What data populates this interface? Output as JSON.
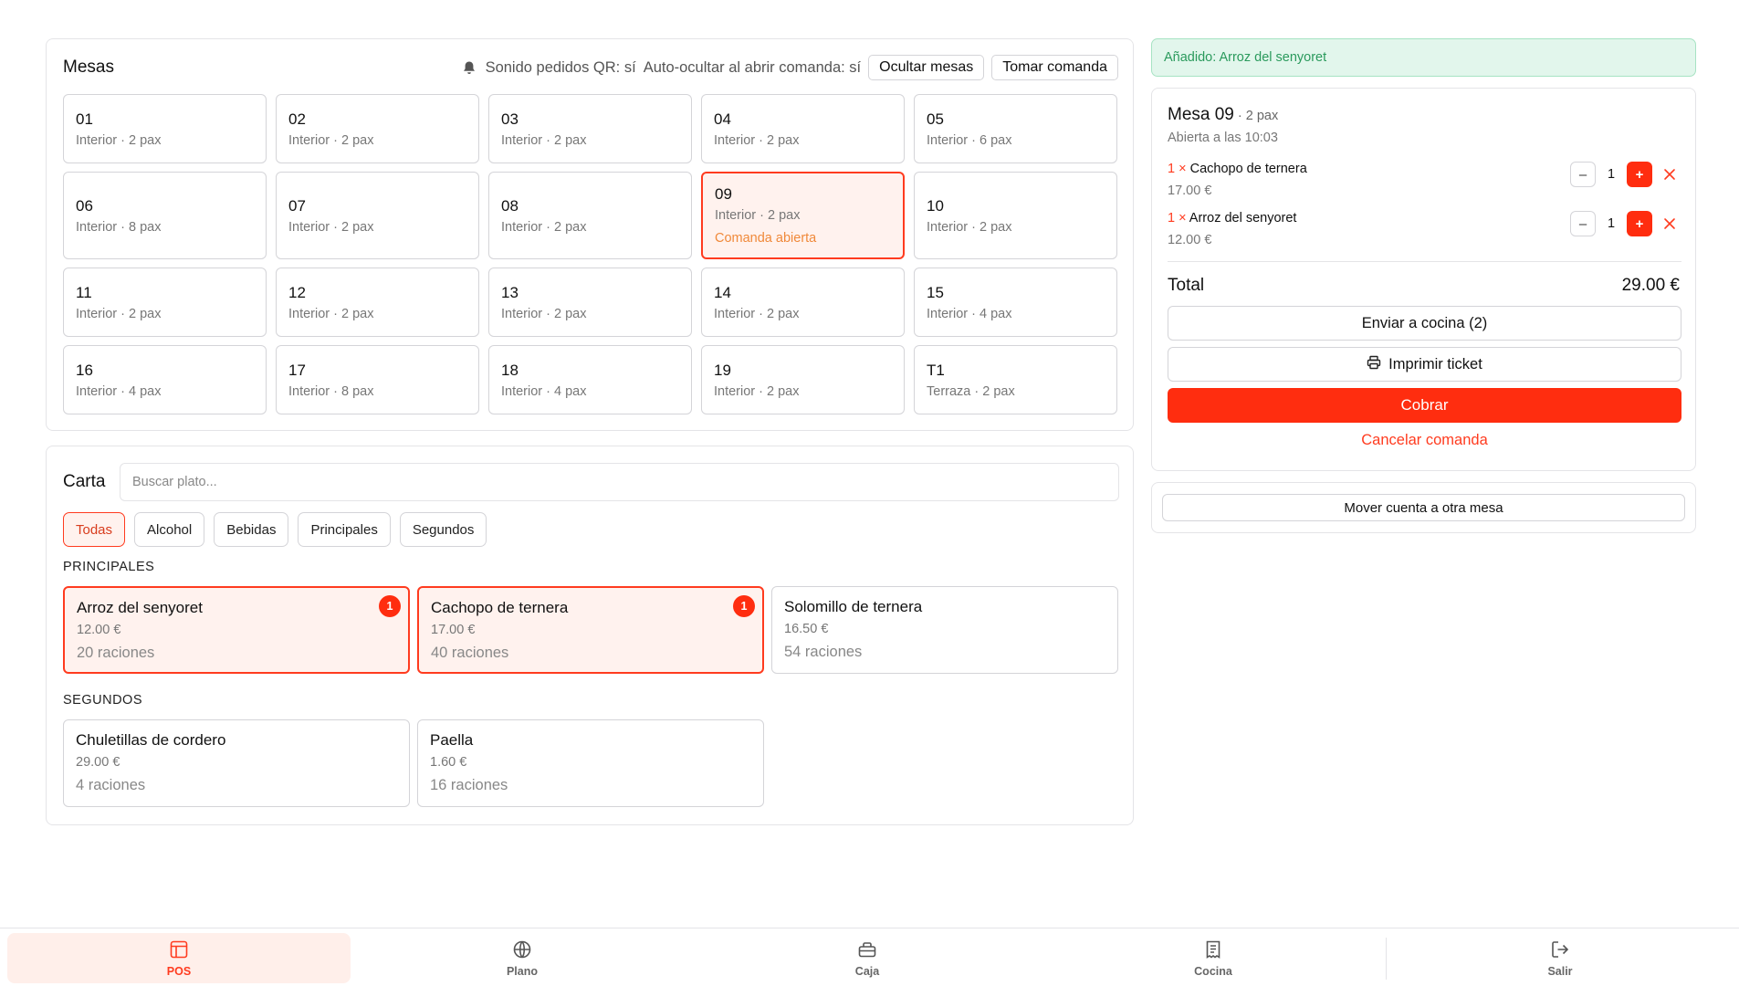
{
  "mesas": {
    "title": "Mesas",
    "qr_sound": "Sonido pedidos QR: sí",
    "auto_hide": "Auto-ocultar al abrir comanda: sí",
    "hide_button": "Ocultar mesas",
    "take_order_button": "Tomar comanda",
    "tables": [
      {
        "num": "01",
        "sub": "Interior · 2 pax"
      },
      {
        "num": "02",
        "sub": "Interior · 2 pax"
      },
      {
        "num": "03",
        "sub": "Interior · 2 pax"
      },
      {
        "num": "04",
        "sub": "Interior · 2 pax"
      },
      {
        "num": "05",
        "sub": "Interior · 6 pax"
      },
      {
        "num": "06",
        "sub": "Interior · 8 pax"
      },
      {
        "num": "07",
        "sub": "Interior · 2 pax"
      },
      {
        "num": "08",
        "sub": "Interior · 2 pax"
      },
      {
        "num": "09",
        "sub": "Interior · 2 pax",
        "status": "Comanda abierta"
      },
      {
        "num": "10",
        "sub": "Interior · 2 pax"
      },
      {
        "num": "11",
        "sub": "Interior · 2 pax"
      },
      {
        "num": "12",
        "sub": "Interior · 2 pax"
      },
      {
        "num": "13",
        "sub": "Interior · 2 pax"
      },
      {
        "num": "14",
        "sub": "Interior · 2 pax"
      },
      {
        "num": "15",
        "sub": "Interior · 4 pax"
      },
      {
        "num": "16",
        "sub": "Interior · 4 pax"
      },
      {
        "num": "17",
        "sub": "Interior · 8 pax"
      },
      {
        "num": "18",
        "sub": "Interior · 4 pax"
      },
      {
        "num": "19",
        "sub": "Interior · 2 pax"
      },
      {
        "num": "T1",
        "sub": "Terraza · 2 pax"
      }
    ]
  },
  "carta": {
    "title": "Carta",
    "search_placeholder": "Buscar plato...",
    "categories": [
      "Todas",
      "Alcohol",
      "Bebidas",
      "Principales",
      "Segundos"
    ],
    "active_category": "Todas",
    "sections": [
      {
        "label": "PRINCIPALES",
        "dishes": [
          {
            "name": "Arroz del senyoret",
            "price": "12.00 €",
            "stock": "20 raciones",
            "badge": "1"
          },
          {
            "name": "Cachopo de ternera",
            "price": "17.00 €",
            "stock": "40 raciones",
            "badge": "1"
          },
          {
            "name": "Solomillo de ternera",
            "price": "16.50 €",
            "stock": "54 raciones"
          }
        ]
      },
      {
        "label": "SEGUNDOS",
        "dishes": [
          {
            "name": "Chuletillas de cordero",
            "price": "29.00 €",
            "stock": "4 raciones"
          },
          {
            "name": "Paella",
            "price": "1.60 €",
            "stock": "16 raciones"
          }
        ]
      }
    ]
  },
  "toast": "Añadido: Arroz del senyoret",
  "order": {
    "title": "Mesa 09",
    "pax": "· 2 pax",
    "opened": "Abierta a las 10:03",
    "lines": [
      {
        "qty": "1 ×",
        "name": "Cachopo de ternera",
        "price": "17.00 €",
        "count": "1"
      },
      {
        "qty": "1 ×",
        "name": "Arroz del senyoret",
        "price": "12.00 €",
        "count": "1"
      }
    ],
    "minus": "–",
    "plus": "+",
    "total_label": "Total",
    "total_value": "29.00 €",
    "send_kitchen": "Enviar a cocina (2)",
    "print_ticket": "Imprimir ticket",
    "charge": "Cobrar",
    "cancel": "Cancelar comanda",
    "move": "Mover cuenta a otra mesa"
  },
  "nav": [
    {
      "label": "POS",
      "icon": "layout-icon",
      "active": true
    },
    {
      "label": "Plano",
      "icon": "globe-icon"
    },
    {
      "label": "Caja",
      "icon": "cash-register-icon"
    },
    {
      "label": "Cocina",
      "icon": "receipt-icon"
    },
    {
      "label": "Salir",
      "icon": "logout-icon"
    }
  ],
  "colors": {
    "accent": "#ff2d0f",
    "accent_bg": "#fff2ee",
    "status_open": "#f0893a",
    "toast_bg": "#e2f6ec",
    "toast_text": "#2a9a5c"
  }
}
